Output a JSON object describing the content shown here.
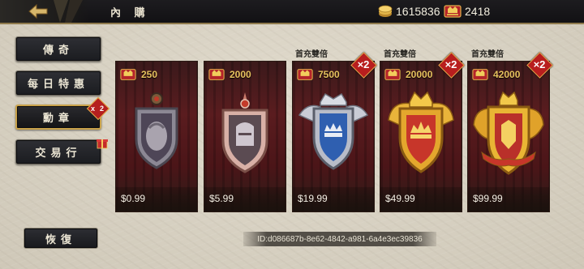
{
  "header": {
    "title": "內 購",
    "gold_amount": "1615836",
    "honor_amount": "2418"
  },
  "nav": {
    "items": [
      {
        "label": "傳奇"
      },
      {
        "label": "每日特惠"
      },
      {
        "label": "勳章",
        "badge": "x2"
      },
      {
        "label": "交易行"
      }
    ],
    "restore_label": "恢復"
  },
  "cards": [
    {
      "amount": "250",
      "price": "$0.99",
      "promo": "",
      "bonus": ""
    },
    {
      "amount": "2000",
      "price": "$5.99",
      "promo": "",
      "bonus": ""
    },
    {
      "amount": "7500",
      "price": "$19.99",
      "promo": "首充雙倍",
      "bonus": "×2"
    },
    {
      "amount": "20000",
      "price": "$49.99",
      "promo": "首充雙倍",
      "bonus": "×2"
    },
    {
      "amount": "42000",
      "price": "$99.99",
      "promo": "首充雙倍",
      "bonus": "×2"
    }
  ],
  "footer": {
    "id_text": "ID:d086687b-8e62-4842-a981-6a4e3ec39836"
  },
  "icons": {
    "back": "back-arrow-icon",
    "gold": "gold-coin-icon",
    "honor": "honor-crest-icon",
    "gift": "gift-icon",
    "medal_tiers": [
      "bronze-medal-icon",
      "silver-knight-medal-icon",
      "blue-crown-medal-icon",
      "gold-crown-medal-icon",
      "royal-gold-medal-icon"
    ]
  },
  "colors": {
    "accent_gold": "#c9a24a",
    "badge_red": "#b81e1e",
    "card_red": "#5a1c1f"
  }
}
